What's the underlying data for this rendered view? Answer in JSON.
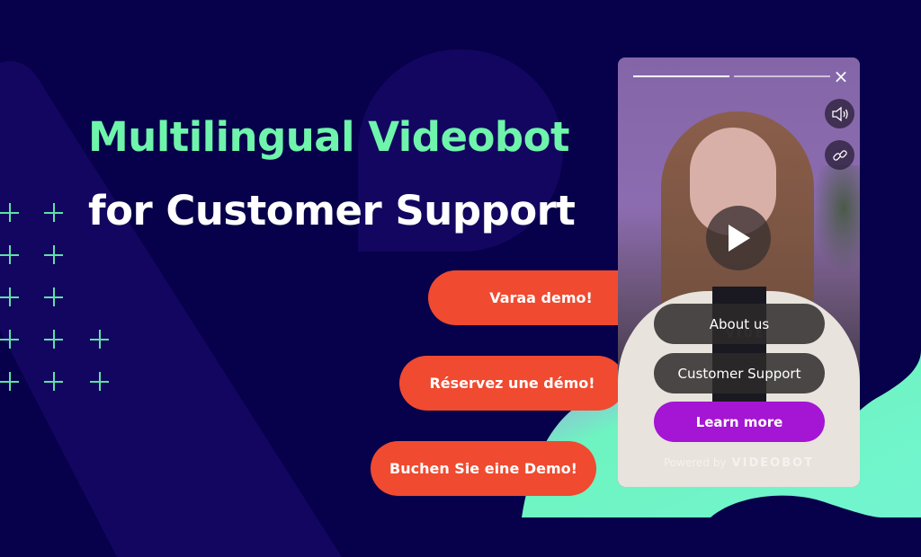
{
  "headline": {
    "line1": "Multilingual Videobot",
    "line2": "for Customer Support"
  },
  "colors": {
    "background": "#07004a",
    "accent_green": "#6ef4ab",
    "cta_orange": "#f04a30",
    "primary_purple": "#a415d4"
  },
  "cta_buttons": [
    {
      "label": "Varaa demo!",
      "language": "Finnish"
    },
    {
      "label": "Réservez une démo!",
      "language": "French"
    },
    {
      "label": "Buchen Sie eine Demo!",
      "language": "German"
    }
  ],
  "videobot": {
    "progress_segments": [
      1,
      0
    ],
    "close_icon": "×",
    "sound_icon": "speaker-icon",
    "link_icon": "link-icon",
    "play_icon": "play-icon",
    "watermark": "VIDEOBOT",
    "options": [
      {
        "label": "About us"
      },
      {
        "label": "Customer Support"
      },
      {
        "label": "Learn more"
      }
    ],
    "powered_by": "Powered by",
    "brand": "VIDEOBOT"
  }
}
